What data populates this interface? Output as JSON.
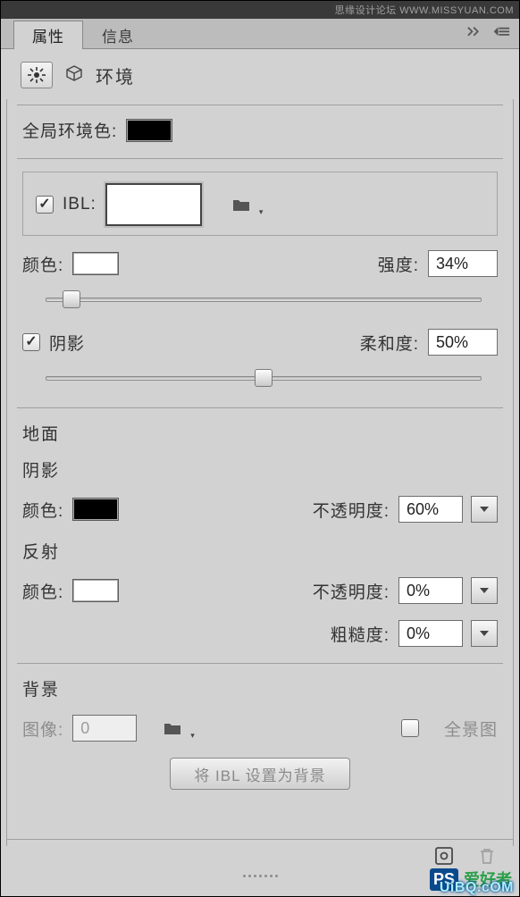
{
  "watermarks": {
    "top": "思缘设计论坛  WWW.MISSYUAN.COM",
    "bottom_ps": "PS",
    "bottom_txt": "爱好者",
    "bottom_url": "UiBQ.cOM"
  },
  "tabs": {
    "items": [
      "属性",
      "信息"
    ],
    "active_index": 0
  },
  "header": {
    "title": "环境"
  },
  "global_ambient": {
    "label": "全局环境色:",
    "swatch_color": "#000000"
  },
  "ibl_section": {
    "ibl_label": "IBL:",
    "ibl_checked": true,
    "color_label": "颜色:",
    "color_swatch": "#ffffff",
    "intensity_label": "强度:",
    "intensity_value": "34%",
    "intensity_fraction": 0.06,
    "shadow_checked": true,
    "shadow_label": "阴影",
    "softness_label": "柔和度:",
    "softness_value": "50%",
    "softness_fraction": 0.5
  },
  "ground": {
    "title": "地面",
    "shadow_title": "阴影",
    "shadow_color_label": "颜色:",
    "shadow_color": "#000000",
    "shadow_opacity_label": "不透明度:",
    "shadow_opacity_value": "60%",
    "reflect_title": "反射",
    "reflect_color_label": "颜色:",
    "reflect_color": "#ffffff",
    "reflect_opacity_label": "不透明度:",
    "reflect_opacity_value": "0%",
    "roughness_label": "粗糙度:",
    "roughness_value": "0%"
  },
  "background": {
    "title": "背景",
    "image_label": "图像:",
    "image_value": "0",
    "panorama_label": "全景图",
    "panorama_checked": false,
    "set_ibl_button": "将 IBL 设置为背景"
  }
}
